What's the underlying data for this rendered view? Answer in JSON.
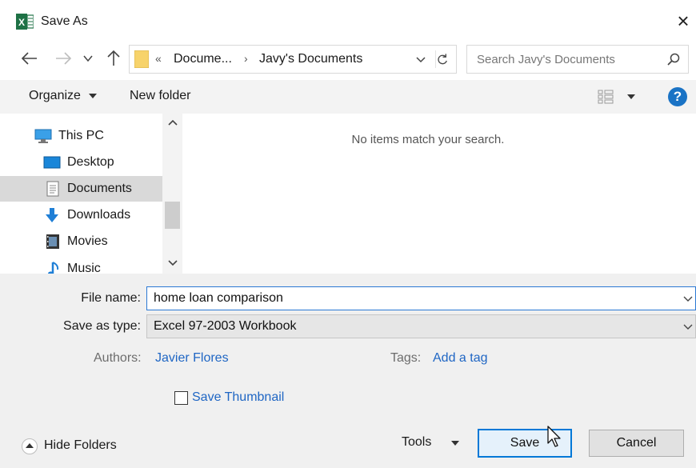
{
  "window": {
    "title": "Save As",
    "close_glyph": "×"
  },
  "address": {
    "chevrons": "«",
    "crumbs": [
      "Docume...",
      "Javy's Documents"
    ],
    "separator": "›"
  },
  "search": {
    "placeholder": "Search Javy's Documents"
  },
  "toolbar": {
    "organize_label": "Organize",
    "new_folder_label": "New folder",
    "help_label": "?"
  },
  "nav": {
    "items": [
      {
        "label": "This PC",
        "icon": "pc-icon"
      },
      {
        "label": "Desktop",
        "icon": "desktop-icon"
      },
      {
        "label": "Documents",
        "icon": "documents-icon",
        "selected": true
      },
      {
        "label": "Downloads",
        "icon": "downloads-icon"
      },
      {
        "label": "Movies",
        "icon": "movies-icon"
      },
      {
        "label": "Music",
        "icon": "music-icon"
      }
    ]
  },
  "content": {
    "empty_message": "No items match your search."
  },
  "form": {
    "filename_label": "File name:",
    "filename_value": "home loan comparison",
    "type_label": "Save as type:",
    "type_value": "Excel 97-2003 Workbook",
    "authors_label": "Authors:",
    "authors_value": "Javier Flores",
    "tags_label": "Tags:",
    "tags_value": "Add a tag",
    "thumbnail_label": "Save Thumbnail",
    "thumbnail_checked": false
  },
  "footer": {
    "hide_folders_label": "Hide Folders",
    "tools_label": "Tools",
    "save_label": "Save",
    "cancel_label": "Cancel"
  },
  "colors": {
    "accent": "#0078d7",
    "link": "#1f66c4",
    "excel_green": "#1e7145",
    "folder_yellow": "#f7d36b"
  }
}
